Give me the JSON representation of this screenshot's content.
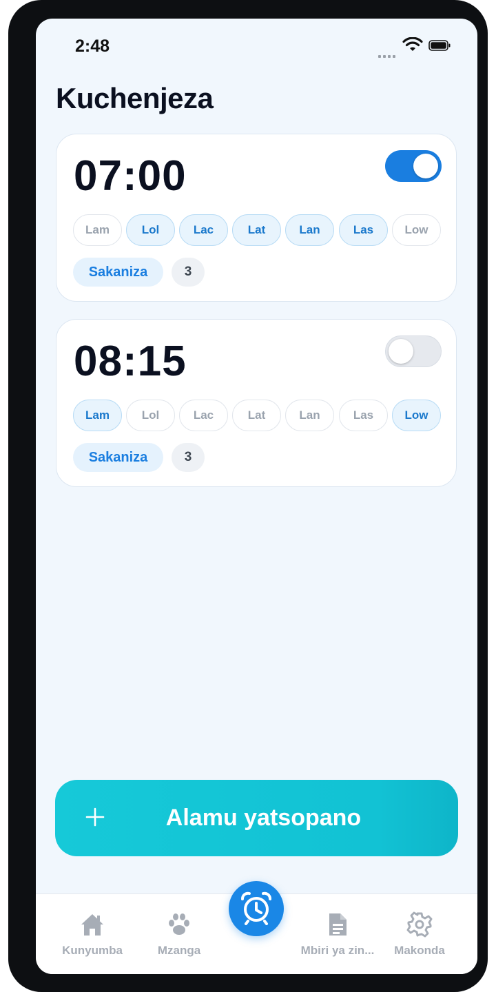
{
  "status": {
    "time": "2:48"
  },
  "page": {
    "title": "Kuchenjeza"
  },
  "alarms": [
    {
      "time": "07:00",
      "enabled": true,
      "days": [
        {
          "label": "Lam",
          "active": false
        },
        {
          "label": "Lol",
          "active": true
        },
        {
          "label": "Lac",
          "active": true
        },
        {
          "label": "Lat",
          "active": true
        },
        {
          "label": "Lan",
          "active": true
        },
        {
          "label": "Las",
          "active": true
        },
        {
          "label": "Low",
          "active": false
        }
      ],
      "snooze_label": "Sakaniza",
      "snooze_count": "3"
    },
    {
      "time": "08:15",
      "enabled": false,
      "days": [
        {
          "label": "Lam",
          "active": true
        },
        {
          "label": "Lol",
          "active": false
        },
        {
          "label": "Lac",
          "active": false
        },
        {
          "label": "Lat",
          "active": false
        },
        {
          "label": "Lan",
          "active": false
        },
        {
          "label": "Las",
          "active": false
        },
        {
          "label": "Low",
          "active": true
        }
      ],
      "snooze_label": "Sakaniza",
      "snooze_count": "3"
    }
  ],
  "new_alarm": {
    "label": "Alamu yatsopano",
    "icon": "plus-icon"
  },
  "tabs": [
    {
      "label": "Kunyumba",
      "icon": "home-icon"
    },
    {
      "label": "Mzanga",
      "icon": "paw-icon"
    },
    {
      "label": "",
      "icon": "alarm-clock-icon"
    },
    {
      "label": "Mbiri ya zin...",
      "icon": "document-icon"
    },
    {
      "label": "Makonda",
      "icon": "gear-icon"
    }
  ],
  "colors": {
    "accent": "#1a7ee0",
    "cta": "#16c9d8",
    "tab_inactive": "#a7adb6"
  }
}
